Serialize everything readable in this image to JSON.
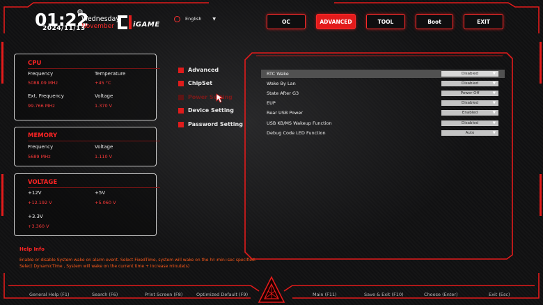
{
  "header": {
    "time": "01:22",
    "weekday": "Wednesday",
    "month": "November",
    "date": "2024/11/13",
    "brand": "iGAME",
    "language": "English",
    "icons": {
      "settings": "gear-icon",
      "language": "globe-icon"
    }
  },
  "tabs": [
    {
      "label": "OC",
      "active": false
    },
    {
      "label": "ADVANCED",
      "active": true
    },
    {
      "label": "TOOL",
      "active": false
    },
    {
      "label": "Boot",
      "active": false
    },
    {
      "label": "EXIT",
      "active": false
    }
  ],
  "cpu": {
    "title": "CPU",
    "frequency_label": "Frequency",
    "frequency_value": "5088.09 MHz",
    "temperature_label": "Temperature",
    "temperature_value": "+45 °C",
    "ext_frequency_label": "Ext. Frequency",
    "ext_frequency_value": "99.766 MHz",
    "voltage_label": "Voltage",
    "voltage_value": "1.370 V"
  },
  "memory": {
    "title": "MEMORY",
    "frequency_label": "Frequency",
    "frequency_value": "5689 MHz",
    "voltage_label": "Voltage",
    "voltage_value": "1.110 V"
  },
  "voltage": {
    "title": "VOLTAGE",
    "v12_label": "+12V",
    "v12_value": "+12.192 V",
    "v5_label": "+5V",
    "v5_value": "+5.060 V",
    "v33_label": "+3.3V",
    "v33_value": "+3.360 V"
  },
  "menu": [
    {
      "label": "Advanced",
      "dim": false
    },
    {
      "label": "ChipSet",
      "dim": false
    },
    {
      "label": "Power Setting",
      "dim": true
    },
    {
      "label": "Device Setting",
      "dim": false
    },
    {
      "label": "Password Setting",
      "dim": false
    }
  ],
  "settings": [
    {
      "label": "RTC Wake",
      "value": "Disabled",
      "selected": true
    },
    {
      "label": "Wake By Lan",
      "value": "Disabled",
      "selected": false
    },
    {
      "label": "State After G3",
      "value": "Power Off",
      "selected": false
    },
    {
      "label": "EUP",
      "value": "Disabled",
      "selected": false
    },
    {
      "label": "Rear USB Power",
      "value": "Enabled",
      "selected": false
    },
    {
      "label": "USB KB/MS Wakeup Function",
      "value": "Disabled",
      "selected": false
    },
    {
      "label": "Debug Code LED Function",
      "value": "Auto",
      "selected": false
    }
  ],
  "help": {
    "title": "Help Info",
    "lines": [
      "Enable or disable System wake on alarm event. Select FixedTime, system will wake on the hr::min::sec specified.",
      "Select DynamicTime , System will wake on the current time + Increase minute(s)"
    ]
  },
  "footer": [
    "General Help (F1)",
    "Search (F6)",
    "Print Screen (F8)",
    "Optimized Default (F9)",
    "Main (F11)",
    "Save & Exit (F10)",
    "Choose (Enter)",
    "Exit (Esc)"
  ],
  "colors": {
    "accent": "#e31b1b",
    "value_red": "#ff3a3a",
    "help_orange": "#ff5a1a"
  }
}
